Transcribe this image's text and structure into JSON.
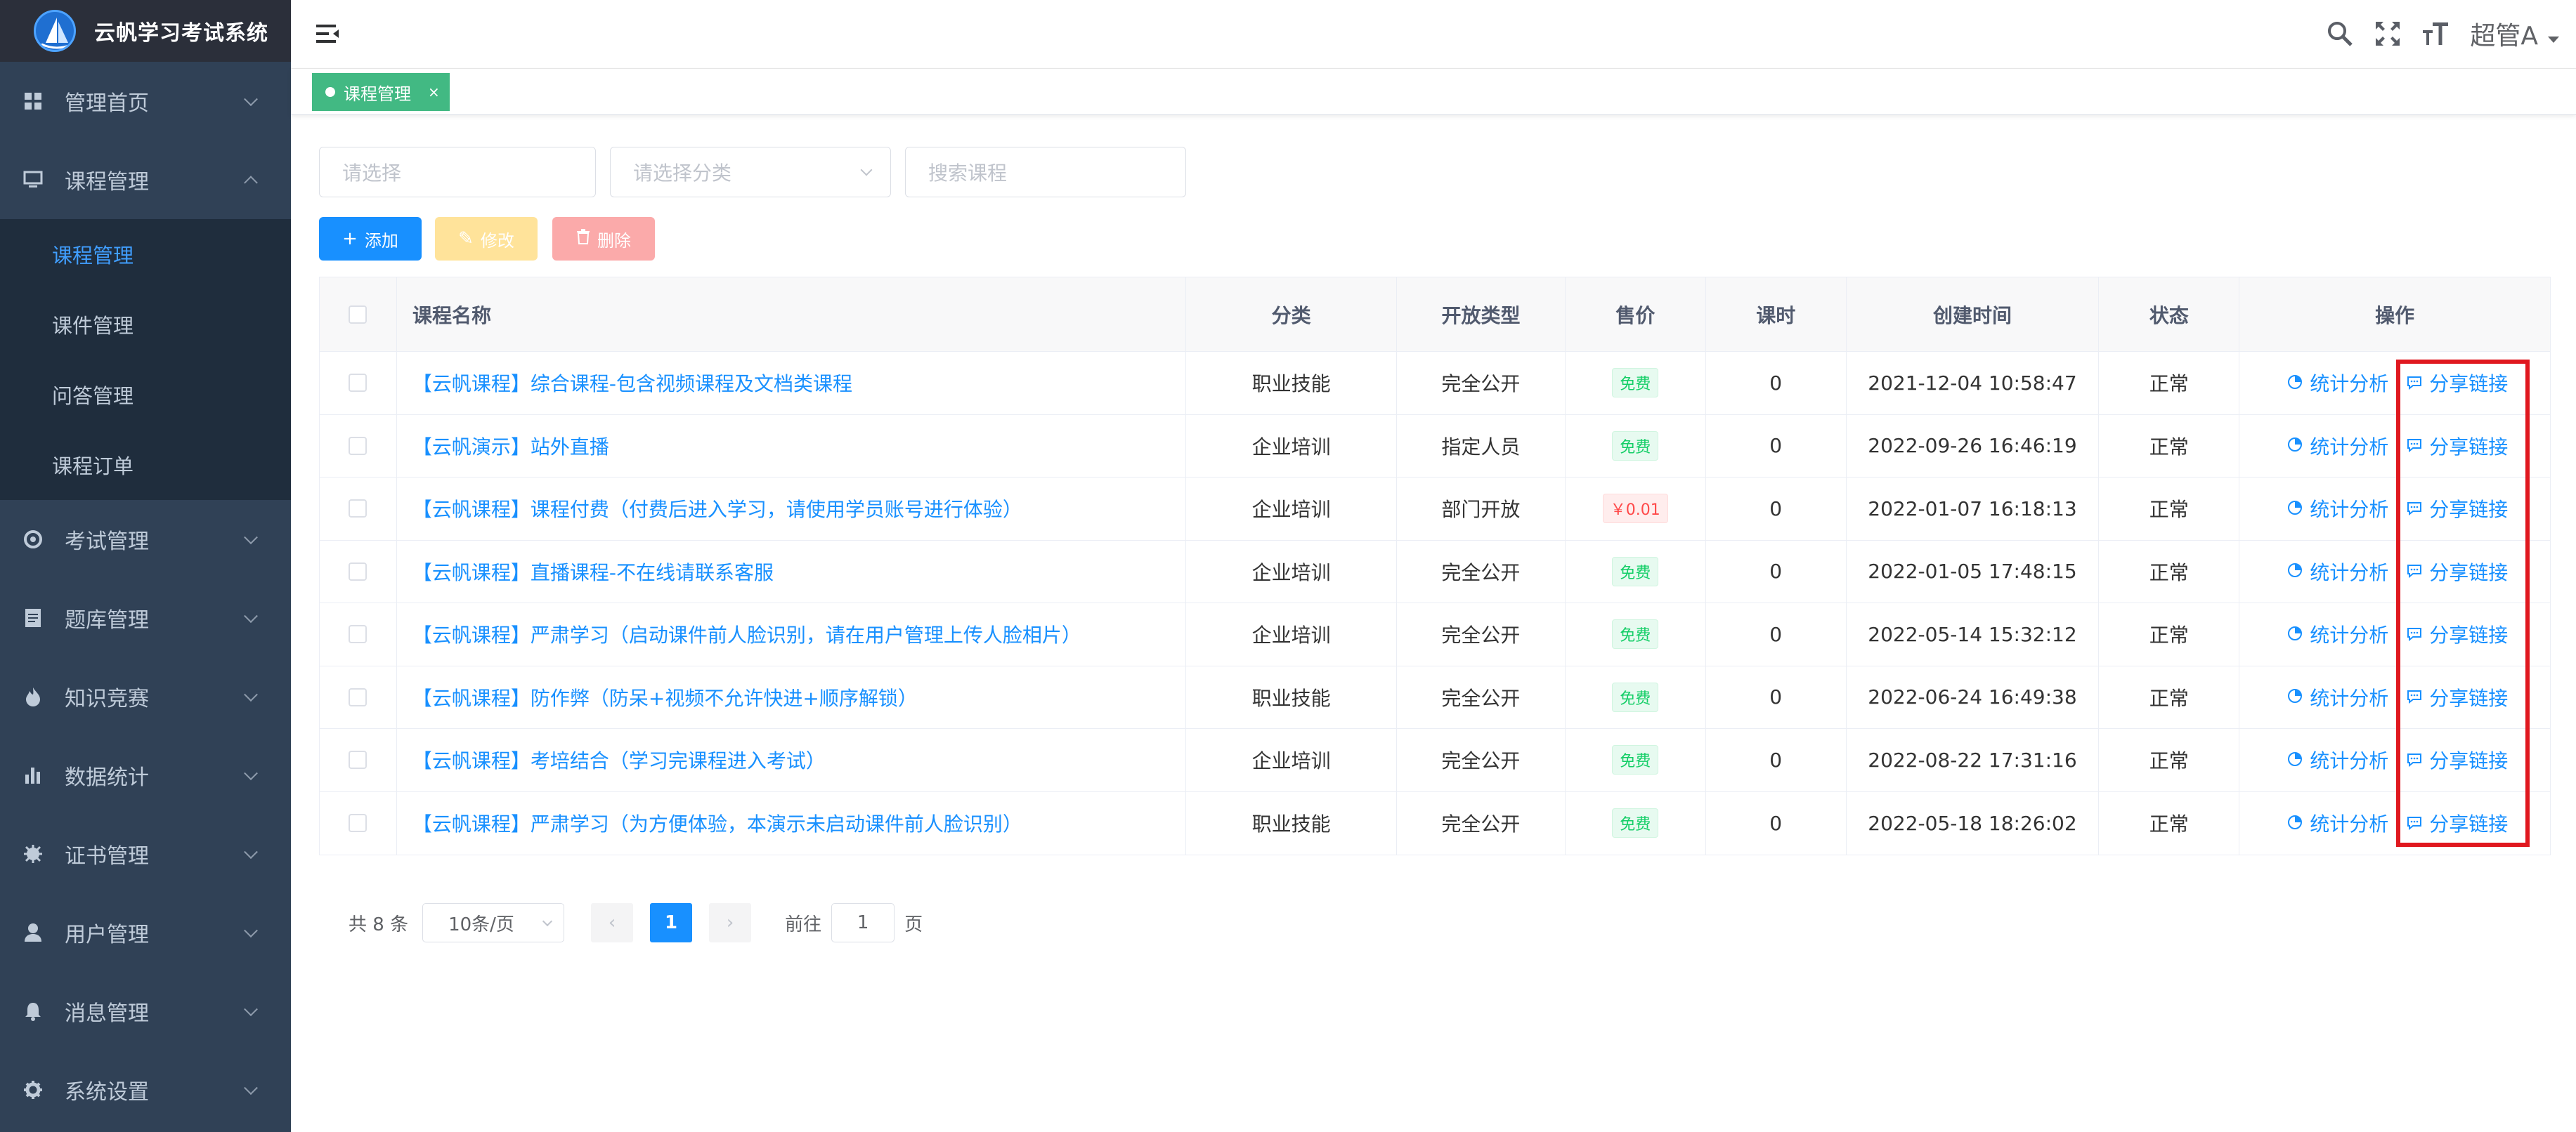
{
  "app": {
    "title": "云帆学习考试系统"
  },
  "sidebar": {
    "items": [
      {
        "label": "管理首页",
        "icon": "dashboard-icon",
        "expanded": false
      },
      {
        "label": "课程管理",
        "icon": "monitor-icon",
        "expanded": true,
        "children": [
          {
            "label": "课程管理",
            "active": true
          },
          {
            "label": "课件管理",
            "active": false
          },
          {
            "label": "问答管理",
            "active": false
          },
          {
            "label": "课程订单",
            "active": false
          }
        ]
      },
      {
        "label": "考试管理",
        "icon": "exam-icon",
        "expanded": false
      },
      {
        "label": "题库管理",
        "icon": "document-icon",
        "expanded": false
      },
      {
        "label": "知识竞赛",
        "icon": "fire-icon",
        "expanded": false
      },
      {
        "label": "数据统计",
        "icon": "bar-chart-icon",
        "expanded": false
      },
      {
        "label": "证书管理",
        "icon": "certificate-icon",
        "expanded": false
      },
      {
        "label": "用户管理",
        "icon": "user-icon",
        "expanded": false
      },
      {
        "label": "消息管理",
        "icon": "bell-icon",
        "expanded": false
      },
      {
        "label": "系统设置",
        "icon": "gear-icon",
        "expanded": false
      }
    ]
  },
  "header": {
    "user": "超管A"
  },
  "tags": [
    {
      "label": "课程管理",
      "close": "×"
    }
  ],
  "filters": {
    "select1_placeholder": "请选择",
    "select2_placeholder": "请选择分类",
    "search_placeholder": "搜索课程"
  },
  "toolbar": {
    "add": "添加",
    "edit": "修改",
    "delete": "删除"
  },
  "table": {
    "headers": [
      "课程名称",
      "分类",
      "开放类型",
      "售价",
      "课时",
      "创建时间",
      "状态",
      "操作"
    ],
    "ops": {
      "stats": "统计分析",
      "share": "分享链接"
    },
    "rows": [
      {
        "name": "【云帆课程】综合课程-包含视频课程及文档类课程",
        "category": "职业技能",
        "open": "完全公开",
        "price": "免费",
        "paid": false,
        "hours": "0",
        "created": "2021-12-04 10:58:47",
        "status": "正常"
      },
      {
        "name": "【云帆演示】站外直播",
        "category": "企业培训",
        "open": "指定人员",
        "price": "免费",
        "paid": false,
        "hours": "0",
        "created": "2022-09-26 16:46:19",
        "status": "正常"
      },
      {
        "name": "【云帆课程】课程付费（付费后进入学习，请使用学员账号进行体验）",
        "category": "企业培训",
        "open": "部门开放",
        "price": "￥0.01",
        "paid": true,
        "hours": "0",
        "created": "2022-01-07 16:18:13",
        "status": "正常"
      },
      {
        "name": "【云帆课程】直播课程-不在线请联系客服",
        "category": "企业培训",
        "open": "完全公开",
        "price": "免费",
        "paid": false,
        "hours": "0",
        "created": "2022-01-05 17:48:15",
        "status": "正常"
      },
      {
        "name": "【云帆课程】严肃学习（启动课件前人脸识别，请在用户管理上传人脸相片）",
        "category": "企业培训",
        "open": "完全公开",
        "price": "免费",
        "paid": false,
        "hours": "0",
        "created": "2022-05-14 15:32:12",
        "status": "正常"
      },
      {
        "name": "【云帆课程】防作弊（防呆+视频不允许快进+顺序解锁）",
        "category": "职业技能",
        "open": "完全公开",
        "price": "免费",
        "paid": false,
        "hours": "0",
        "created": "2022-06-24 16:49:38",
        "status": "正常"
      },
      {
        "name": "【云帆课程】考培结合（学习完课程进入考试）",
        "category": "企业培训",
        "open": "完全公开",
        "price": "免费",
        "paid": false,
        "hours": "0",
        "created": "2022-08-22 17:31:16",
        "status": "正常"
      },
      {
        "name": "【云帆课程】严肃学习（为方便体验，本演示未启动课件前人脸识别）",
        "category": "职业技能",
        "open": "完全公开",
        "price": "免费",
        "paid": false,
        "hours": "0",
        "created": "2022-05-18 18:26:02",
        "status": "正常"
      }
    ]
  },
  "pagination": {
    "total": "共 8 条",
    "page_size": "10条/页",
    "prev": "‹",
    "next": "›",
    "current": "1",
    "goto_label": "前往",
    "goto_value": "1",
    "page_suffix": "页"
  }
}
